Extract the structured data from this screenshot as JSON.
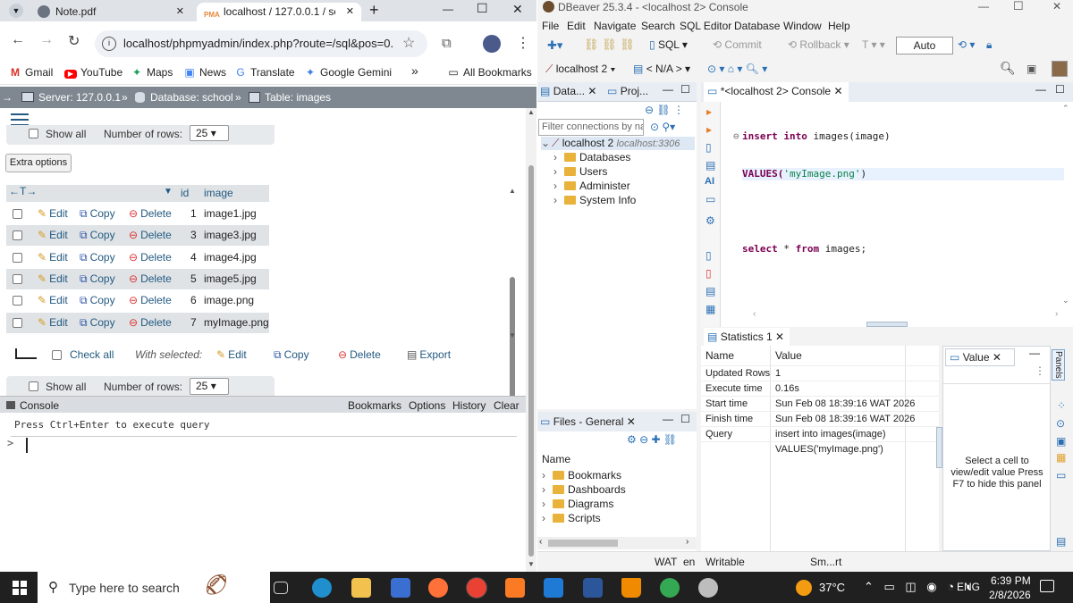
{
  "chrome": {
    "tabs": [
      {
        "label": "Note.pdf",
        "close": "✕"
      },
      {
        "label": "localhost / 127.0.0.1 / scho",
        "close": "✕"
      }
    ],
    "new_tab": "+",
    "window_controls": {
      "min": "—",
      "max": "☐",
      "close": "✕"
    },
    "url": "localhost/phpmyadmin/index.php?route=/sql&pos=0...",
    "bookmarks": [
      "Gmail",
      "YouTube",
      "Maps",
      "News",
      "Translate",
      "Google Gemini"
    ],
    "bookmarks_more": "»",
    "all_bookmarks": "All Bookmarks"
  },
  "pma": {
    "breadcrumb": {
      "server": "Server: 127.0.0.1",
      "database": "Database: school",
      "table": "Table: images",
      "sep": "»"
    },
    "show_all": "Show all",
    "number_of_rows_label": "Number of rows:",
    "number_of_rows_value": "25",
    "extra_options": "Extra options",
    "columns": [
      "id",
      "image"
    ],
    "actions": {
      "edit": "Edit",
      "copy": "Copy",
      "delete": "Delete"
    },
    "rows": [
      {
        "id": "1",
        "image": "image1.jpg"
      },
      {
        "id": "3",
        "image": "image3.jpg"
      },
      {
        "id": "4",
        "image": "image4.jpg"
      },
      {
        "id": "5",
        "image": "image5.jpg"
      },
      {
        "id": "6",
        "image": "image.png"
      },
      {
        "id": "7",
        "image": "myImage.png"
      }
    ],
    "check_all": "Check all",
    "with_selected": "With selected:",
    "bulk": {
      "edit": "Edit",
      "copy": "Copy",
      "delete": "Delete",
      "export": "Export"
    },
    "console": {
      "title": "Console",
      "links": [
        "Bookmarks",
        "Options",
        "History",
        "Clear"
      ],
      "hint": "Press Ctrl+Enter to execute query",
      "prompt": ">"
    }
  },
  "dbeaver": {
    "title": "DBeaver 25.3.4 - <localhost 2> Console",
    "window_controls": {
      "min": "—",
      "max": "☐",
      "close": "✕"
    },
    "menu": [
      "File",
      "Edit",
      "Navigate",
      "Search",
      "SQL Editor",
      "Database",
      "Window",
      "Help"
    ],
    "toolbar": {
      "sql": "SQL",
      "commit": "Commit",
      "rollback": "Rollback",
      "mode": "Auto"
    },
    "toolbar2": {
      "connection": "localhost 2",
      "schema": "< N/A >"
    },
    "nav_tabs": [
      "Data...",
      "Proj..."
    ],
    "filter_placeholder": "Filter connections by na",
    "tree_root": {
      "name": "localhost 2",
      "host": "localhost:3306"
    },
    "tree_items": [
      "Databases",
      "Users",
      "Administer",
      "System Info"
    ],
    "editor_tab": "*<localhost 2> Console",
    "sql": {
      "line1_kw": "insert into",
      "line1_rest": " images(image)",
      "line2_kw": "VALUES(",
      "line2_str": "'myImage.png'",
      "line2_end": ")",
      "line3_kw1": "select",
      "line3_mid": " * ",
      "line3_kw2": "from",
      "line3_rest": " images;"
    },
    "stats_tab": "Statistics 1",
    "stats_header": {
      "name": "Name",
      "value": "Value"
    },
    "stats": [
      {
        "name": "Updated Rows",
        "value": "1"
      },
      {
        "name": "Execute time",
        "value": "0.16s"
      },
      {
        "name": "Start time",
        "value": "Sun Feb 08 18:39:16 WAT 2026"
      },
      {
        "name": "Finish time",
        "value": "Sun Feb 08 18:39:16 WAT 2026"
      },
      {
        "name": "Query",
        "value": "insert into images(image)"
      },
      {
        "name": "",
        "value": "VALUES('myImage.png')"
      }
    ],
    "value_panel": {
      "tab": "Value",
      "message": "Select a cell to view/edit value Press F7 to hide this panel"
    },
    "panels_label": "Panels",
    "files_tab": "Files - General",
    "files_header": "Name",
    "files": [
      "Bookmarks",
      "Dashboards",
      "Diagrams",
      "Scripts"
    ],
    "status": [
      "WAT",
      "en",
      "Writable",
      "Sm...rt"
    ]
  },
  "taskbar": {
    "search_placeholder": "Type here to search",
    "weather": "37°C",
    "lang": "ENG",
    "time": "6:39 PM",
    "date": "2/8/2026"
  }
}
